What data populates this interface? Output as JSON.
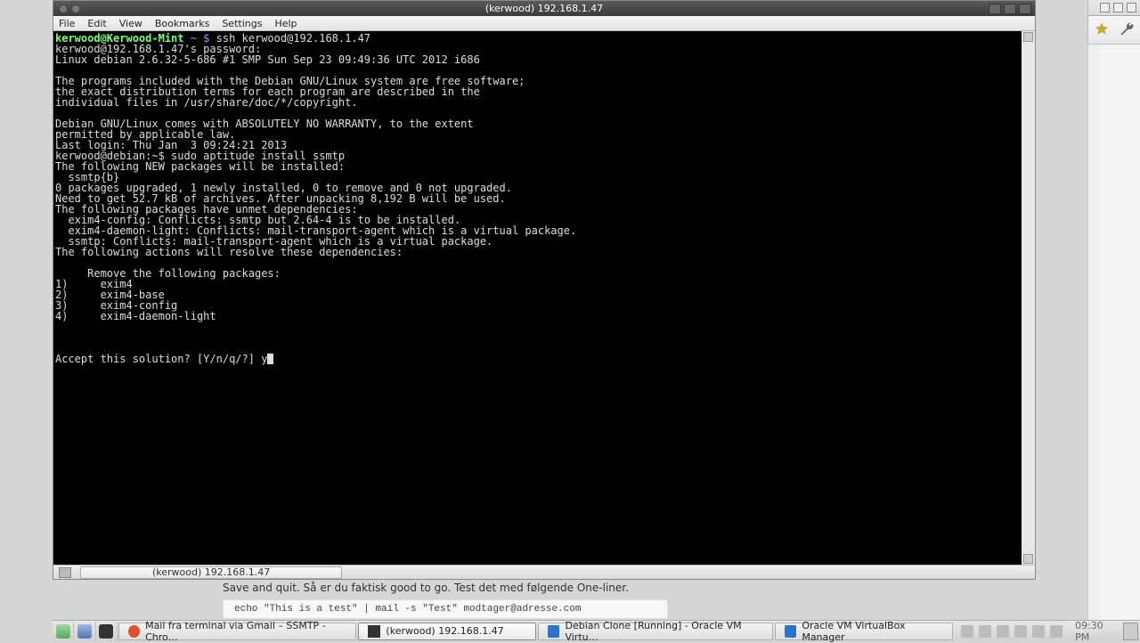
{
  "window": {
    "title": "(kerwood) 192.168.1.47",
    "menus": [
      "File",
      "Edit",
      "View",
      "Bookmarks",
      "Settings",
      "Help"
    ],
    "status_label": "(kerwood) 192.168.1.47"
  },
  "terminal": {
    "prompt_user": "kerwood@Kerwood-Mint",
    "prompt_tilde": " ~ $ ",
    "prompt_cmd": "ssh kerwood@192.168.1.47",
    "lines": [
      "kerwood@192.168.1.47's password:",
      "Linux debian 2.6.32-5-686 #1 SMP Sun Sep 23 09:49:36 UTC 2012 i686",
      "",
      "The programs included with the Debian GNU/Linux system are free software;",
      "the exact distribution terms for each program are described in the",
      "individual files in /usr/share/doc/*/copyright.",
      "",
      "Debian GNU/Linux comes with ABSOLUTELY NO WARRANTY, to the extent",
      "permitted by applicable law.",
      "Last login: Thu Jan  3 09:24:21 2013",
      "kerwood@debian:~$ sudo aptitude install ssmtp",
      "The following NEW packages will be installed:",
      "  ssmtp{b}",
      "0 packages upgraded, 1 newly installed, 0 to remove and 0 not upgraded.",
      "Need to get 52.7 kB of archives. After unpacking 8,192 B will be used.",
      "The following packages have unmet dependencies:",
      "  exim4-config: Conflicts: ssmtp but 2.64-4 is to be installed.",
      "  exim4-daemon-light: Conflicts: mail-transport-agent which is a virtual package.",
      "  ssmtp: Conflicts: mail-transport-agent which is a virtual package.",
      "The following actions will resolve these dependencies:",
      "",
      "     Remove the following packages:",
      "1)     exim4",
      "2)     exim4-base",
      "3)     exim4-config",
      "4)     exim4-daemon-light",
      "",
      "",
      "",
      "Accept this solution? [Y/n/q/?] y"
    ]
  },
  "page": {
    "text": "Save and quit. Så er du faktisk good to go. Test det med følgende One-liner.",
    "code": "echo \"This is a test\" | mail -s \"Test\" modtager@adresse.com"
  },
  "taskbar": {
    "tasks": [
      {
        "label": "Mail fra terminal via Gmail – SSMTP - Chro…",
        "icon": "#e05030",
        "active": false
      },
      {
        "label": "(kerwood) 192.168.1.47",
        "icon": "#333333",
        "active": true
      },
      {
        "label": "Debian Clone [Running] - Oracle VM Virtu…",
        "icon": "#2a74d0",
        "active": false
      },
      {
        "label": "Oracle VM VirtualBox Manager",
        "icon": "#2a74d0",
        "active": false
      }
    ],
    "clock": "09:30 PM"
  }
}
